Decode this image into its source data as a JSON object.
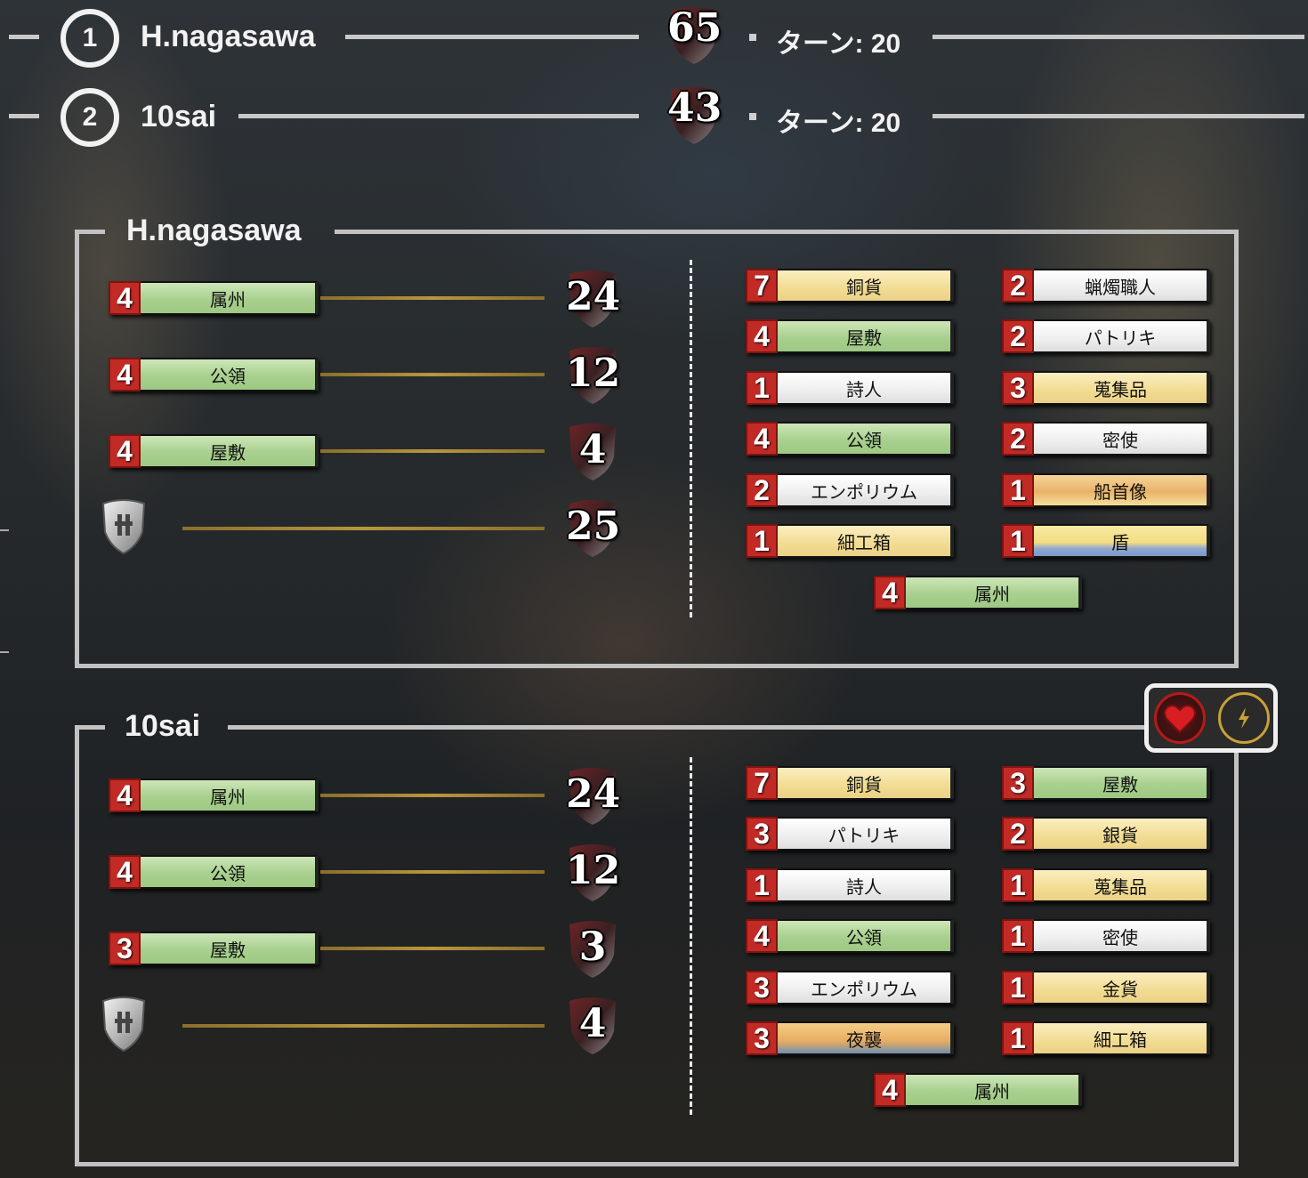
{
  "scoreboard": {
    "players": [
      {
        "rank": "1",
        "name": "H.nagasawa",
        "score": "65",
        "turns": "ターン: 20"
      },
      {
        "rank": "2",
        "name": "10sai",
        "score": "43",
        "turns": "ターン: 20"
      }
    ]
  },
  "panels": [
    {
      "title": "H.nagasawa",
      "scoring_rows": [
        {
          "count": "4",
          "label": "属州",
          "color": "green",
          "points": "24"
        },
        {
          "count": "4",
          "label": "公領",
          "color": "green",
          "points": "12"
        },
        {
          "count": "4",
          "label": "屋敷",
          "color": "green",
          "points": "4"
        },
        {
          "emblem": "shield-emblem-icon",
          "points": "25"
        }
      ],
      "deck": [
        {
          "count": "7",
          "label": "銅貨",
          "color": "yellow"
        },
        {
          "count": "2",
          "label": "蝋燭職人",
          "color": "white"
        },
        {
          "count": "4",
          "label": "屋敷",
          "color": "green"
        },
        {
          "count": "2",
          "label": "パトリキ",
          "color": "white"
        },
        {
          "count": "1",
          "label": "詩人",
          "color": "white"
        },
        {
          "count": "3",
          "label": "蒐集品",
          "color": "yellow"
        },
        {
          "count": "4",
          "label": "公領",
          "color": "green"
        },
        {
          "count": "2",
          "label": "密使",
          "color": "white"
        },
        {
          "count": "2",
          "label": "エンポリウム",
          "color": "white"
        },
        {
          "count": "1",
          "label": "船首像",
          "color": "orange"
        },
        {
          "count": "1",
          "label": "細工箱",
          "color": "yellow"
        },
        {
          "count": "1",
          "label": "盾",
          "color": "yellow-blue"
        },
        {
          "count": "4",
          "label": "属州",
          "color": "green"
        }
      ]
    },
    {
      "title": "10sai",
      "scoring_rows": [
        {
          "count": "4",
          "label": "属州",
          "color": "green",
          "points": "24"
        },
        {
          "count": "4",
          "label": "公領",
          "color": "green",
          "points": "12"
        },
        {
          "count": "3",
          "label": "屋敷",
          "color": "green",
          "points": "3"
        },
        {
          "emblem": "shield-emblem-icon",
          "points": "4"
        }
      ],
      "deck": [
        {
          "count": "7",
          "label": "銅貨",
          "color": "yellow"
        },
        {
          "count": "3",
          "label": "屋敷",
          "color": "green"
        },
        {
          "count": "3",
          "label": "パトリキ",
          "color": "white"
        },
        {
          "count": "2",
          "label": "銀貨",
          "color": "yellow"
        },
        {
          "count": "1",
          "label": "詩人",
          "color": "white"
        },
        {
          "count": "1",
          "label": "蒐集品",
          "color": "yellow"
        },
        {
          "count": "4",
          "label": "公領",
          "color": "green"
        },
        {
          "count": "1",
          "label": "密使",
          "color": "white"
        },
        {
          "count": "3",
          "label": "エンポリウム",
          "color": "white"
        },
        {
          "count": "1",
          "label": "金貨",
          "color": "yellow"
        },
        {
          "count": "3",
          "label": "夜襲",
          "color": "orange-blue"
        },
        {
          "count": "1",
          "label": "細工箱",
          "color": "yellow"
        },
        {
          "count": "4",
          "label": "属州",
          "color": "green"
        }
      ]
    }
  ],
  "reactions": {
    "icons": [
      "heart-icon",
      "lightning-icon"
    ],
    "heart_color": "#c0191c",
    "lightning_color": "#c8a03a"
  }
}
